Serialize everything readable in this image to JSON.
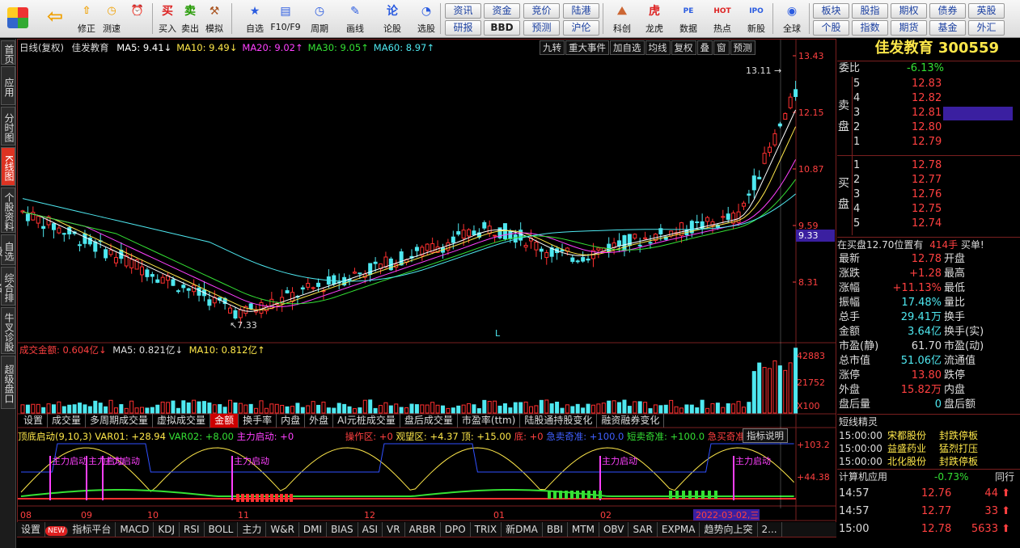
{
  "toolbar": {
    "items": [
      {
        "label": "买入",
        "icon": "buy-icon"
      },
      {
        "label": "卖出",
        "icon": "sell-icon"
      },
      {
        "label": "模拟",
        "icon": "hammer-icon"
      },
      {
        "label": "自选",
        "icon": "star-icon"
      },
      {
        "label": "F10/F9",
        "icon": "f10-icon"
      },
      {
        "label": "周期",
        "icon": "period-icon"
      },
      {
        "label": "画线",
        "icon": "pen-icon"
      },
      {
        "label": "论股",
        "icon": "forum-icon"
      },
      {
        "label": "选股",
        "icon": "pick-icon"
      },
      {
        "label": "科创",
        "icon": "kc-icon"
      },
      {
        "label": "龙虎",
        "icon": "tiger-icon"
      },
      {
        "label": "数据",
        "icon": "pe-icon"
      },
      {
        "label": "热点",
        "icon": "hot-icon"
      },
      {
        "label": "新股",
        "icon": "ipo-icon"
      },
      {
        "label": "全球",
        "icon": "globe-icon"
      }
    ],
    "left_small": [
      "修正",
      "测速"
    ],
    "grid1": [
      "资讯",
      "资金",
      "竞价",
      "陆港"
    ],
    "grid2": [
      "研报",
      "BBD",
      "预测",
      "沪伦"
    ],
    "grid3": [
      "板块",
      "股指",
      "期权",
      "债券",
      "英股"
    ],
    "grid4": [
      "个股",
      "指数",
      "期货",
      "基金",
      "外汇"
    ]
  },
  "left_tabs": [
    "首页",
    "应用",
    "分时图",
    "K线图",
    "个股资料",
    "自选股",
    "综合排名",
    "牛叉诊股",
    "超级盘口"
  ],
  "chart": {
    "title": "日线(复权)",
    "stock": "佳发教育",
    "ma": [
      {
        "name": "MA5",
        "value": "9.41",
        "arrow": "↓",
        "color": "#ffffff"
      },
      {
        "name": "MA10",
        "value": "9.49",
        "arrow": "↓",
        "color": "#ffe84a"
      },
      {
        "name": "MA20",
        "value": "9.02",
        "arrow": "↑",
        "color": "#ff40ff"
      },
      {
        "name": "MA30",
        "value": "9.05",
        "arrow": "↑",
        "color": "#34e034"
      },
      {
        "name": "MA60",
        "value": "8.97",
        "arrow": "↑",
        "color": "#4ee8f0"
      }
    ],
    "top_buttons": [
      "九转",
      "重大事件",
      "加自选",
      "均线",
      "复权",
      "叠",
      "窗",
      "预测"
    ],
    "price_axis": [
      "13.43",
      "12.15",
      "10.87",
      "9.59",
      "8.31"
    ],
    "current_price_tag": "9.33",
    "high_label": "13.11",
    "low_label": "7.33",
    "marker": "L",
    "volume": {
      "label": "成交金额",
      "value": "0.604亿",
      "arrow": "↓",
      "ma5": "MA5: 0.821亿",
      "ma5_arrow": "↓",
      "ma10": "MA10: 0.812亿",
      "ma10_arrow": "↑",
      "axis": [
        "42883",
        "21752",
        "X100"
      ]
    },
    "sub_tabs": [
      "设置",
      "成交量",
      "多周期成交量",
      "虚拟成交量",
      "金额",
      "换手率",
      "内盘",
      "外盘",
      "AI元桩成交量",
      "盘后成交量",
      "市盈率(ttm)",
      "陆股通持股变化",
      "融资融券变化"
    ],
    "indicator": {
      "name": "顶底启动(9,10,3)",
      "var01": "VAR01: +28.94",
      "var02": "VAR02: +8.00",
      "zl": "主力启动: +0",
      "cz": "操作区: +0",
      "gw": "观望区: +4.37",
      "top": "顶: +15.00",
      "bottom": "底: +0",
      "jm": "急卖奇准: +100.0",
      "dm": "短卖奇准: +100.0",
      "jm2": "急买奇准",
      "help": "指标说明",
      "axis": [
        "+103.2",
        "+44.38"
      ],
      "flag": "主力启动"
    },
    "months": [
      "08",
      "09",
      "10",
      "11",
      "12",
      "01",
      "02"
    ],
    "date_tag": "2022-03-02,三"
  },
  "bottom_tabs": [
    "设置",
    "指标平台",
    "MACD",
    "KDJ",
    "RSI",
    "BOLL",
    "主力",
    "W&R",
    "DMI",
    "BIAS",
    "ASI",
    "VR",
    "ARBR",
    "DPO",
    "TRIX",
    "新DMA",
    "BBI",
    "MTM",
    "OBV",
    "SAR",
    "EXPMA",
    "趋势向上突",
    "2..."
  ],
  "quote": {
    "name": "佳发教育",
    "code": "300559",
    "weibi_label": "委比",
    "weibi": "-6.13%",
    "sell_label": "卖盘",
    "buy_label": "买盘",
    "sells": [
      {
        "n": "5",
        "p": "12.83",
        "v": ""
      },
      {
        "n": "4",
        "p": "12.82",
        "v": ""
      },
      {
        "n": "3",
        "p": "12.81",
        "v": ""
      },
      {
        "n": "2",
        "p": "12.80",
        "v": ""
      },
      {
        "n": "1",
        "p": "12.79",
        "v": ""
      }
    ],
    "buys": [
      {
        "n": "1",
        "p": "12.78"
      },
      {
        "n": "2",
        "p": "12.77"
      },
      {
        "n": "3",
        "p": "12.76"
      },
      {
        "n": "4",
        "p": "12.75"
      },
      {
        "n": "5",
        "p": "12.74"
      }
    ],
    "line": "在买盘12.70位置有",
    "line_vol": "414手",
    "line_tail": "买单!",
    "stats": [
      {
        "l": "最新",
        "v": "12.78",
        "l2": "开盘",
        "c": "red"
      },
      {
        "l": "涨跌",
        "v": "+1.28",
        "l2": "最高",
        "c": "red"
      },
      {
        "l": "涨幅",
        "v": "+11.13%",
        "l2": "最低",
        "c": "red"
      },
      {
        "l": "振幅",
        "v": "17.48%",
        "l2": "量比",
        "c": "cyan"
      },
      {
        "l": "总手",
        "v": "29.41万",
        "l2": "换手",
        "c": "cyan"
      },
      {
        "l": "金额",
        "v": "3.64亿",
        "l2": "换手(实)",
        "c": "cyan"
      },
      {
        "l": "市盈(静)",
        "v": "61.70",
        "l2": "市盈(动)",
        "c": "wht"
      },
      {
        "l": "总市值",
        "v": "51.06亿",
        "l2": "流通值",
        "c": "cyan"
      },
      {
        "l": "涨停",
        "v": "13.80",
        "l2": "跌停",
        "c": "red"
      },
      {
        "l": "外盘",
        "v": "15.82万",
        "l2": "内盘",
        "c": "red"
      },
      {
        "l": "盘后量",
        "v": "0",
        "l2": "盘后额",
        "c": "cyan"
      }
    ],
    "news_title": "短线精灵",
    "news": [
      {
        "t": "15:00:00",
        "s": "宋都股份",
        "e": "封跌停板"
      },
      {
        "t": "15:00:00",
        "s": "益盛药业",
        "e": "猛烈打压"
      },
      {
        "t": "15:00:00",
        "s": "北化股份",
        "e": "封跌停板"
      }
    ],
    "sector": "计算机应用",
    "sector_chg": "-0.73%",
    "sector_tab": "同行",
    "ticks": [
      {
        "t": "14:57",
        "p": "12.76",
        "v": "44"
      },
      {
        "t": "14:57",
        "p": "12.77",
        "v": "33"
      },
      {
        "t": "15:00",
        "p": "12.78",
        "v": "5633"
      }
    ]
  }
}
